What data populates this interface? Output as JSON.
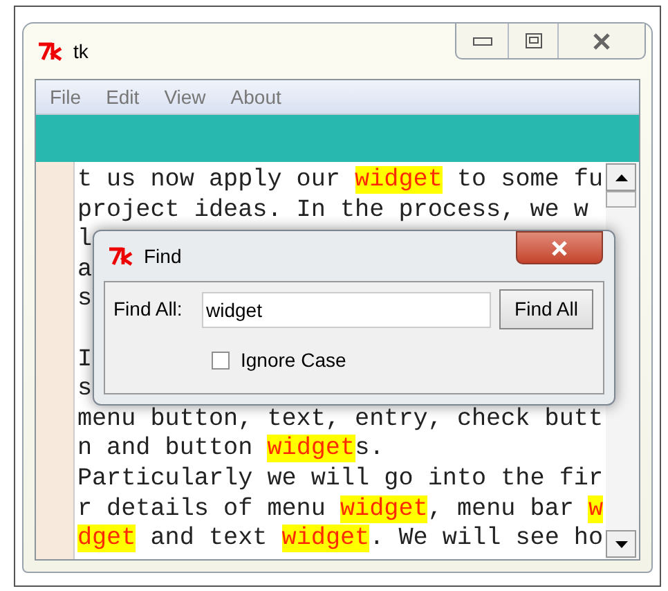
{
  "window": {
    "title": "tk"
  },
  "menu": [
    "File",
    "Edit",
    "View",
    "About"
  ],
  "text_lines": [
    {
      "segments": [
        {
          "text": "t us now apply our ",
          "highlight": false
        },
        {
          "text": "widget",
          "highlight": true
        },
        {
          "text": " to some fu",
          "highlight": false
        }
      ]
    },
    {
      "segments": [
        {
          "text": "project ideas. In the process, we w",
          "highlight": false
        }
      ]
    },
    {
      "segments": [
        {
          "text": "l",
          "highlight": false
        }
      ]
    },
    {
      "segments": [
        {
          "text": "a",
          "highlight": false
        }
      ]
    },
    {
      "segments": [
        {
          "text": "s",
          "highlight": false
        }
      ]
    },
    {
      "segments": [
        {
          "text": "I",
          "highlight": false
        }
      ],
      "blank_line_before": true
    },
    {
      "segments": [
        {
          "text": "s",
          "highlight": false
        }
      ]
    },
    {
      "segments": [
        {
          "text": "menu button, text, entry, check butt",
          "highlight": false
        }
      ]
    },
    {
      "segments": [
        {
          "text": "n and button ",
          "highlight": false
        },
        {
          "text": "widget",
          "highlight": true
        },
        {
          "text": "s.",
          "highlight": false
        }
      ]
    },
    {
      "segments": [
        {
          "text": "Particularly we will go into the fir",
          "highlight": false
        }
      ]
    },
    {
      "segments": [
        {
          "text": "r details of menu ",
          "highlight": false
        },
        {
          "text": "widget",
          "highlight": true
        },
        {
          "text": ", menu bar ",
          "highlight": false
        },
        {
          "text": "w",
          "highlight": true
        }
      ]
    },
    {
      "segments": [
        {
          "text": "dget",
          "highlight": true
        },
        {
          "text": " and text ",
          "highlight": false
        },
        {
          "text": "widget",
          "highlight": true
        },
        {
          "text": ". We will see ho",
          "highlight": false
        }
      ]
    }
  ],
  "dialog": {
    "title": "Find",
    "label": "Find All:",
    "value": "widget",
    "button": "Find All",
    "checkbox": {
      "label": "Ignore Case",
      "checked": false
    }
  }
}
